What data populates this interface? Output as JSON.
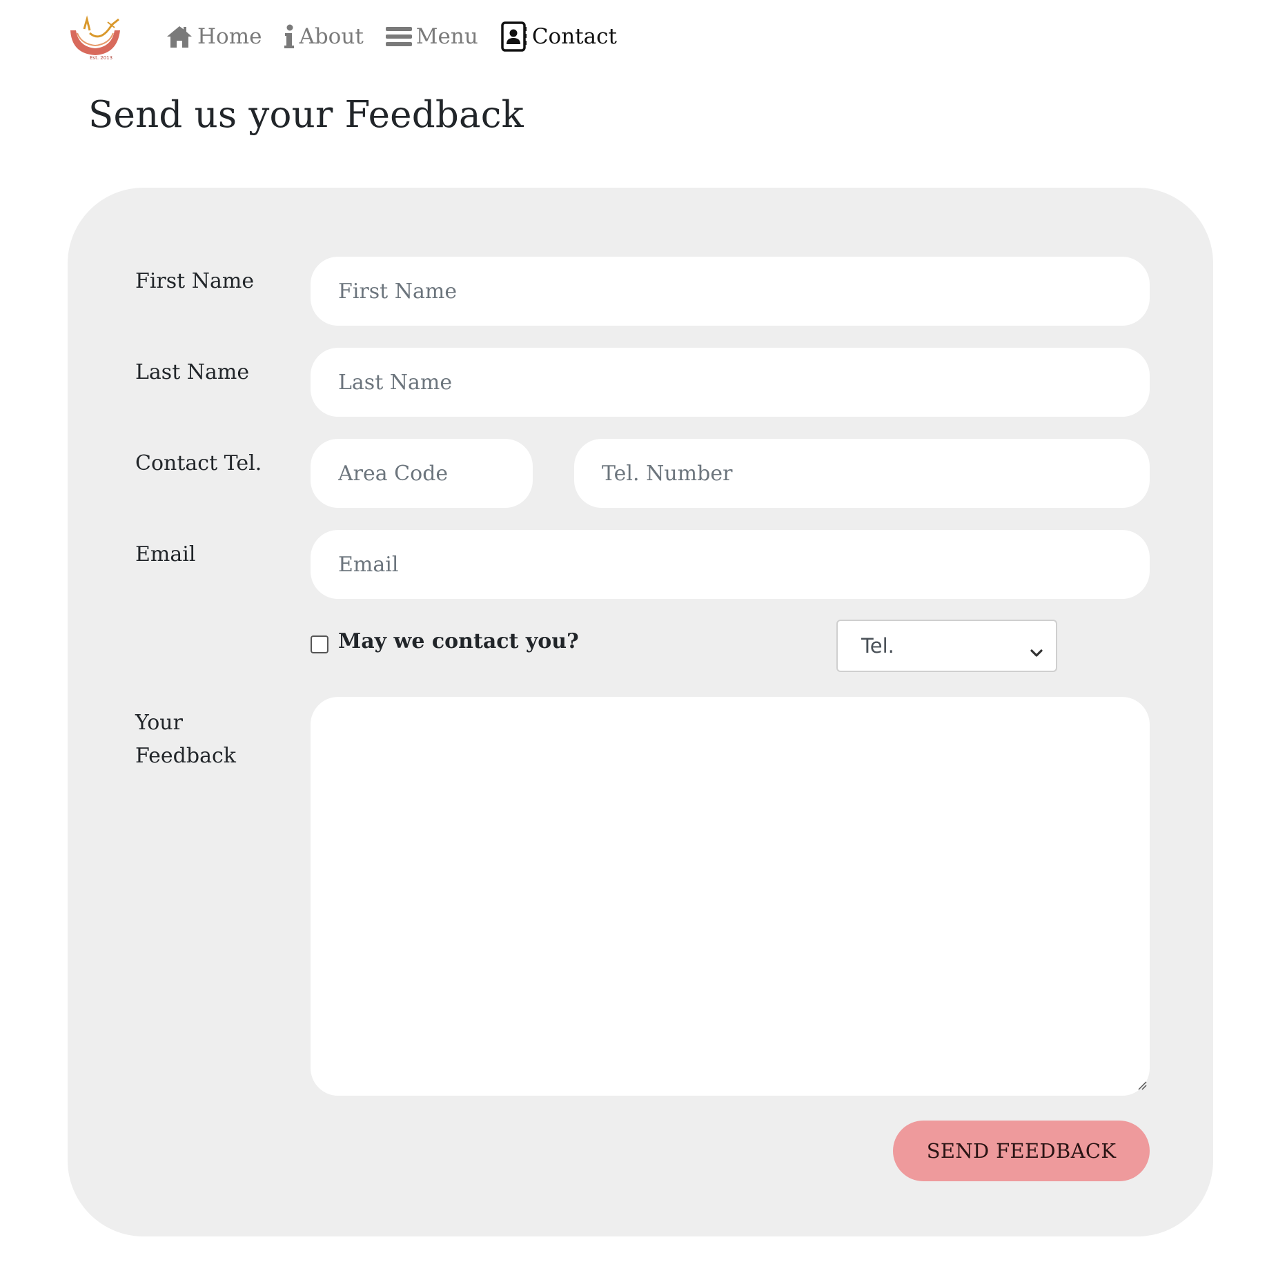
{
  "nav": {
    "logo_text": "Est. 2013",
    "items": [
      {
        "label": "Home",
        "icon": "home-icon",
        "active": false
      },
      {
        "label": "About",
        "icon": "info-icon",
        "active": false
      },
      {
        "label": "Menu",
        "icon": "bars-icon",
        "active": false
      },
      {
        "label": "Contact",
        "icon": "contact-book-icon",
        "active": true
      }
    ]
  },
  "page": {
    "title": "Send us your Feedback"
  },
  "form": {
    "first_name": {
      "label": "First Name",
      "placeholder": "First Name"
    },
    "last_name": {
      "label": "Last Name",
      "placeholder": "Last Name"
    },
    "contact_tel": {
      "label": "Contact Tel.",
      "area_placeholder": "Area Code",
      "number_placeholder": "Tel. Number"
    },
    "email": {
      "label": "Email",
      "placeholder": "Email"
    },
    "contact_consent": {
      "label": "May we contact you?",
      "checked": false
    },
    "contact_method": {
      "selected": "Tel."
    },
    "feedback": {
      "label_line1": "Your",
      "label_line2": "Feedback"
    },
    "submit_label": "SEND FEEDBACK"
  },
  "colors": {
    "panel_bg": "#eeeeee",
    "button_bg": "#ee9a9c",
    "nav_inactive": "#7a7a7a",
    "nav_active": "#111111"
  }
}
